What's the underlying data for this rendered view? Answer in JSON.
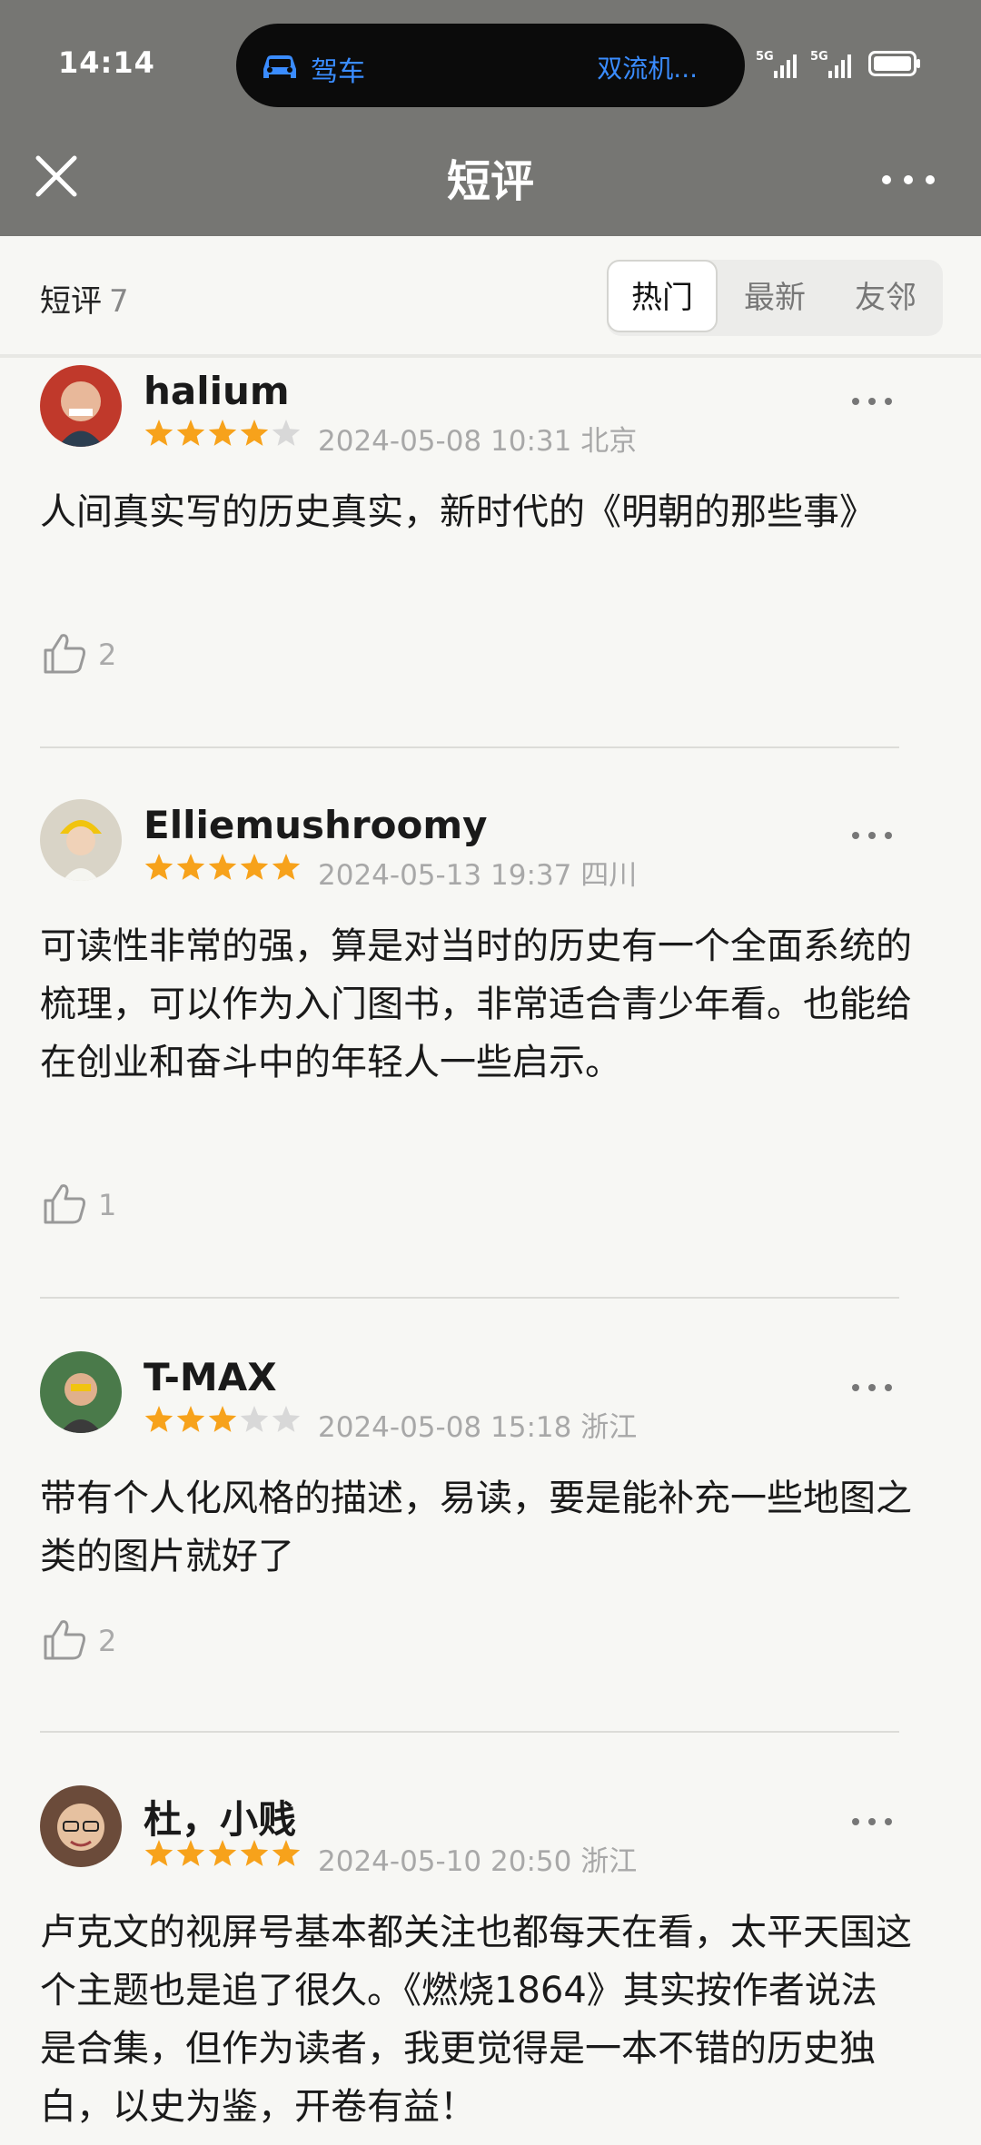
{
  "status_bar": {
    "time": "14:14",
    "nav_mode": "驾车",
    "destination": "双流机..."
  },
  "header": {
    "title": "短评"
  },
  "tabs": {
    "label": "短评",
    "count": "7",
    "options": [
      "热门",
      "最新",
      "友邻"
    ],
    "selected": "热门"
  },
  "reviews": [
    {
      "user": "halium",
      "rating": 4,
      "date": "2024-05-08 10:31",
      "location": "北京",
      "text": "人间真实写的历史真实，新时代的《明朝的那些事》",
      "likes": "2"
    },
    {
      "user": "Elliemushroomy",
      "rating": 5,
      "date": "2024-05-13 19:37",
      "location": "四川",
      "text": "可读性非常的强，算是对当时的历史有一个全面系统的梳理，可以作为入门图书，非常适合青少年看。也能给在创业和奋斗中的年轻人一些启示。",
      "likes": "1"
    },
    {
      "user": "T-MAX",
      "rating": 3,
      "date": "2024-05-08 15:18",
      "location": "浙江",
      "text": "带有个人化风格的描述，易读，要是能补充一些地图之类的图片就好了",
      "likes": "2"
    },
    {
      "user": "杜，小贱",
      "rating": 5,
      "date": "2024-05-10 20:50",
      "location": "浙江",
      "text": "卢克文的视屏号基本都关注也都每天在看，太平天国这个主题也是追了很久。《燃烧1864》其实按作者说法是合集，但作为读者，我更觉得是一本不错的历史独白，以史为鉴，开卷有益！",
      "likes": ""
    }
  ],
  "colors": {
    "star_on": "#f7a21b",
    "star_off": "#d8d8d8",
    "accent": "#3a8cff",
    "header_bg": "#767673"
  }
}
